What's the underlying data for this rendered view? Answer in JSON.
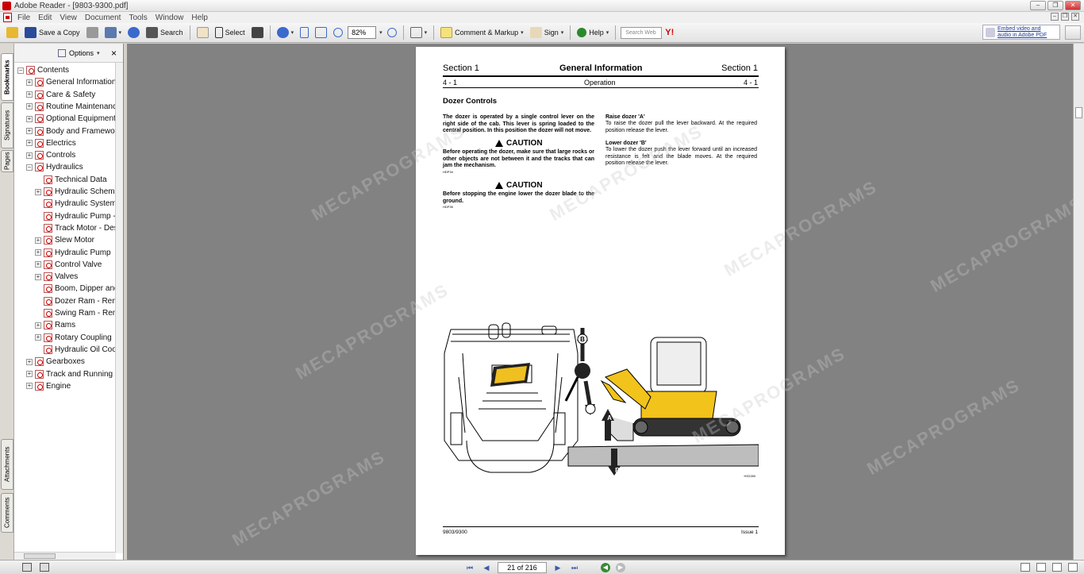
{
  "window": {
    "title": "Adobe Reader - [9803-9300.pdf]"
  },
  "menu": [
    "File",
    "Edit",
    "View",
    "Document",
    "Tools",
    "Window",
    "Help"
  ],
  "toolbar": {
    "save_copy": "Save a Copy",
    "search": "Search",
    "select": "Select",
    "zoom": "82%",
    "comment_markup": "Comment & Markup",
    "sign": "Sign",
    "help": "Help",
    "search_web_placeholder": "Search Web",
    "yahoo": "Y!",
    "embed_line1": "Embed video and",
    "embed_line2": "audio in Adobe PDF"
  },
  "left_tabs": [
    "Bookmarks",
    "Signatures",
    "Pages",
    "Attachments",
    "Comments"
  ],
  "bookmarks_panel": {
    "options_label": "Options",
    "close": "×"
  },
  "bookmarks": [
    {
      "label": "Contents",
      "level": 0,
      "expander": "−"
    },
    {
      "label": "General Information",
      "level": 1,
      "expander": "+"
    },
    {
      "label": "Care & Safety",
      "level": 1,
      "expander": "+"
    },
    {
      "label": "Routine Maintenance",
      "level": 1,
      "expander": "+"
    },
    {
      "label": "Optional Equipment",
      "level": 1,
      "expander": "+"
    },
    {
      "label": "Body and Framework",
      "level": 1,
      "expander": "+"
    },
    {
      "label": "Electrics",
      "level": 1,
      "expander": "+"
    },
    {
      "label": "Controls",
      "level": 1,
      "expander": "+"
    },
    {
      "label": "Hydraulics",
      "level": 1,
      "expander": "−"
    },
    {
      "label": "Technical Data",
      "level": 2,
      "expander": ""
    },
    {
      "label": "Hydraulic Schematic",
      "level": 2,
      "expander": "+"
    },
    {
      "label": "Hydraulic System",
      "level": 2,
      "expander": ""
    },
    {
      "label": "Hydraulic Pump - ",
      "level": 2,
      "expander": ""
    },
    {
      "label": "Track Motor - Des",
      "level": 2,
      "expander": ""
    },
    {
      "label": "Slew Motor",
      "level": 2,
      "expander": "+"
    },
    {
      "label": "Hydraulic Pump",
      "level": 2,
      "expander": "+"
    },
    {
      "label": "Control Valve",
      "level": 2,
      "expander": "+"
    },
    {
      "label": "Valves",
      "level": 2,
      "expander": "+"
    },
    {
      "label": "Boom, Dipper and",
      "level": 2,
      "expander": ""
    },
    {
      "label": "Dozer Ram - Rem",
      "level": 2,
      "expander": ""
    },
    {
      "label": "Swing Ram - Rem",
      "level": 2,
      "expander": ""
    },
    {
      "label": "Rams",
      "level": 2,
      "expander": "+"
    },
    {
      "label": "Rotary Coupling",
      "level": 2,
      "expander": "+"
    },
    {
      "label": "Hydraulic Oil Coo",
      "level": 2,
      "expander": ""
    },
    {
      "label": "Gearboxes",
      "level": 1,
      "expander": "+"
    },
    {
      "label": "Track and Running G",
      "level": 1,
      "expander": "+"
    },
    {
      "label": "Engine",
      "level": 1,
      "expander": "+"
    }
  ],
  "document_page": {
    "header_left": "Section 1",
    "header_center": "General Information",
    "header_right": "Section 1",
    "sub_left": "4 - 1",
    "sub_center": "Operation",
    "sub_right": "4 - 1",
    "heading": "Dozer Controls",
    "intro": "The dozer is operated by a single control lever on the right side of the cab. This lever is spring loaded to the central position. In this position the dozer will not move.",
    "caution_label": "CAUTION",
    "caution1": "Before operating the dozer, make sure that large rocks or other objects are not between it and the tracks that can jam the mechanism.",
    "caution1_code": "HDP34",
    "caution2": "Before stopping the engine lower the dozer blade to the ground.",
    "caution2_code": "HDP35",
    "raise_title": "Raise dozer 'A'",
    "raise_text": "To raise the dozer pull the lever backward. At the required position release the lever.",
    "lower_title": "Lower dozer 'B'",
    "lower_text": "To lower the dozer push the lever forward until an increased resistance is felt and the blade moves. At the required position release the lever.",
    "figure_code": "HS2280",
    "label_a": "A",
    "label_b": "B",
    "footer_left": "9803/9300",
    "footer_right": "Issue 1"
  },
  "status": {
    "page_indicator": "21 of 216"
  },
  "watermark": "MECAPROGRAMS"
}
